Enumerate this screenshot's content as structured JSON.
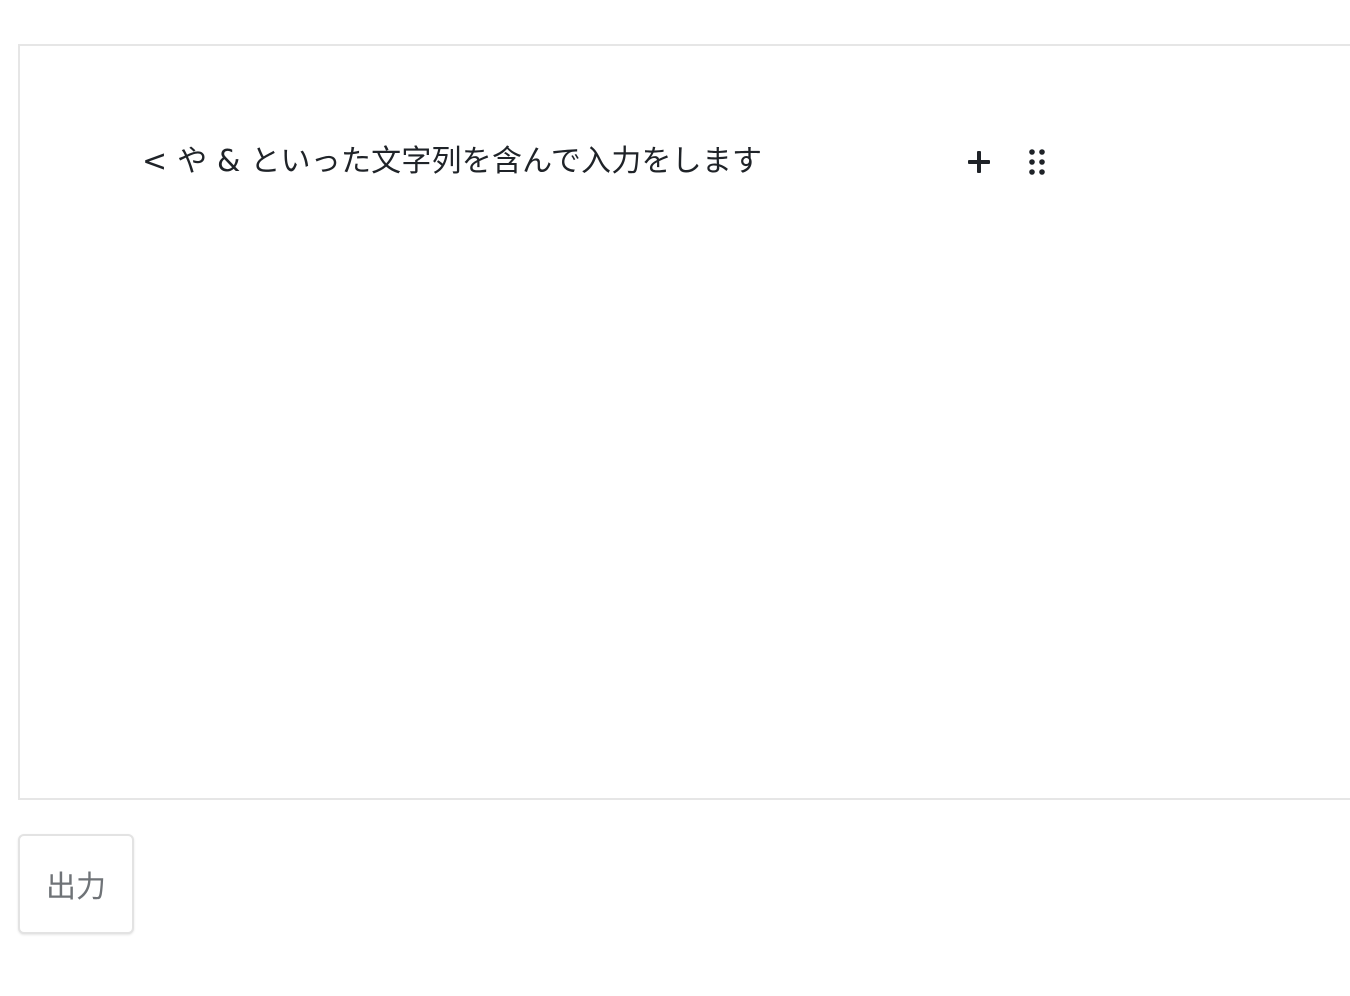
{
  "editor": {
    "blocks": [
      {
        "text": "< や & といった文字列を含んで入力をします"
      }
    ],
    "tools": {
      "add_icon": "plus-icon",
      "drag_icon": "drag-handle-icon"
    }
  },
  "actions": {
    "output_label": "出力"
  }
}
